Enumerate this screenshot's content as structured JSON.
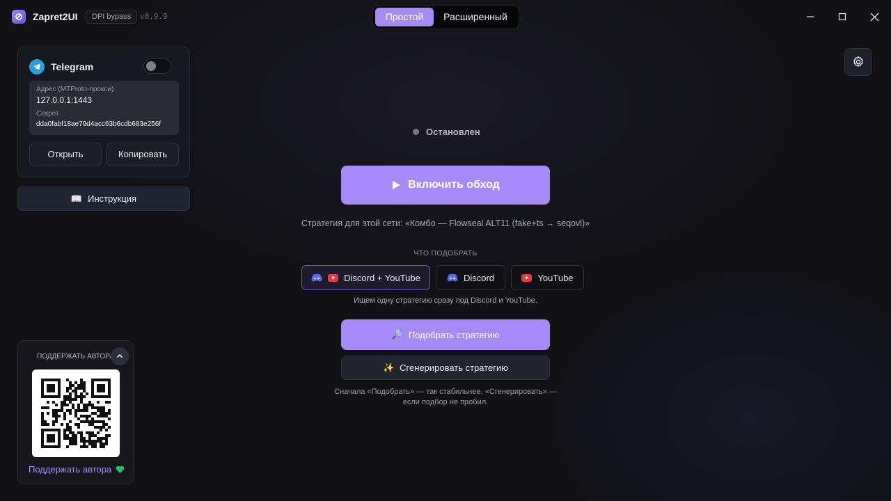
{
  "app": {
    "title": "Zapret2UI",
    "badge": "DPI bypass",
    "version": "v0.9.9",
    "modes": [
      "Простой",
      "Расширенный"
    ],
    "active_mode": "Простой",
    "logo_icon": "zapret-logo-icon"
  },
  "window_controls": [
    "minimize-icon",
    "maximize-icon",
    "close-icon"
  ],
  "telegram": {
    "title": "Telegram",
    "enabled": false,
    "address_label": "Адрес (MTProto-прокси)",
    "address": "127.0.0.1:1443",
    "secret_label": "Секрет",
    "secret": "dda0fabf18ae79d4acc63b6cdb683e256f",
    "open_label": "Открыть",
    "copy_label": "Копировать",
    "accent": "#29a0da"
  },
  "guide": {
    "icon": "📖",
    "label": "Инструкция"
  },
  "donate": {
    "title": "ПОДДЕРЖАТЬ АВТОРА",
    "link_label": "Поддержать автора",
    "heart_color": "#22c55e"
  },
  "main": {
    "status": "Остановлен",
    "status_color": "#7a7a86",
    "toggle_label": "Включить обход",
    "strategy_line": "Стратегия для этой сети: «Комбо — Flowseal ALT11 (fake+ts → seqovl)»",
    "pick_section_label": "ЧТО ПОДОБРАТЬ",
    "targets": [
      {
        "label": "Discord + YouTube",
        "selected": true
      },
      {
        "label": "Discord",
        "selected": false
      },
      {
        "label": "YouTube",
        "selected": false
      }
    ],
    "target_hint": "Ищем одну стратегию сразу под Discord и YouTube.",
    "pick_icon": "🔎",
    "pick_label": "Подобрать стратегию",
    "gen_icon": "✨",
    "gen_label": "Сгенерировать стратегию",
    "bottom_hint_line1": "Сначала «Подобрать» — так стабильнее. «Сгенерировать» —",
    "bottom_hint_line2": "если подбор не пробил."
  },
  "colors": {
    "accent": "#a58bf5",
    "background": "#111116",
    "discord": "#5865f2",
    "youtube": "#e53947"
  }
}
